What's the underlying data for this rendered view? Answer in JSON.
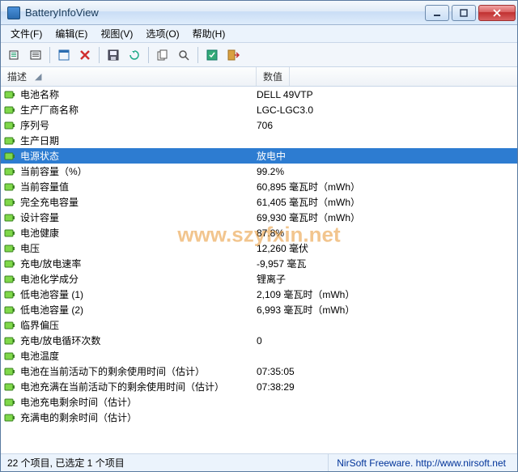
{
  "title": "BatteryInfoView",
  "menu": [
    "文件(F)",
    "编辑(E)",
    "视图(V)",
    "选项(O)",
    "帮助(H)"
  ],
  "columns": {
    "desc": "描述",
    "value": "数值"
  },
  "rows": [
    {
      "desc": "电池名称",
      "value": "DELL 49VTP",
      "selected": false
    },
    {
      "desc": "生产厂商名称",
      "value": "LGC-LGC3.0",
      "selected": false
    },
    {
      "desc": "序列号",
      "value": "    706",
      "selected": false
    },
    {
      "desc": "生产日期",
      "value": "",
      "selected": false
    },
    {
      "desc": "电源状态",
      "value": "放电中",
      "selected": true
    },
    {
      "desc": "当前容量（%）",
      "value": "99.2%",
      "selected": false
    },
    {
      "desc": "当前容量值",
      "value": "60,895 毫瓦时（mWh）",
      "selected": false
    },
    {
      "desc": "完全充电容量",
      "value": "61,405 毫瓦时（mWh）",
      "selected": false
    },
    {
      "desc": "设计容量",
      "value": "69,930 毫瓦时（mWh）",
      "selected": false
    },
    {
      "desc": "电池健康",
      "value": "87.8%",
      "selected": false
    },
    {
      "desc": "电压",
      "value": "12,260 毫伏",
      "selected": false
    },
    {
      "desc": "充电/放电速率",
      "value": "-9,957 毫瓦",
      "selected": false
    },
    {
      "desc": "电池化学成分",
      "value": "锂离子",
      "selected": false
    },
    {
      "desc": "低电池容量 (1)",
      "value": "2,109 毫瓦时（mWh）",
      "selected": false
    },
    {
      "desc": "低电池容量 (2)",
      "value": "6,993 毫瓦时（mWh）",
      "selected": false
    },
    {
      "desc": "临界偏压",
      "value": "",
      "selected": false
    },
    {
      "desc": "充电/放电循环次数",
      "value": "0",
      "selected": false
    },
    {
      "desc": "电池温度",
      "value": "",
      "selected": false
    },
    {
      "desc": "电池在当前活动下的剩余使用时间（估计）",
      "value": "07:35:05",
      "selected": false
    },
    {
      "desc": "电池充满在当前活动下的剩余使用时间（估计）",
      "value": "07:38:29",
      "selected": false
    },
    {
      "desc": "电池充电剩余时间（估计）",
      "value": "",
      "selected": false
    },
    {
      "desc": "充满电的剩余时间（估计）",
      "value": "",
      "selected": false
    }
  ],
  "status": {
    "left": "22 个项目, 已选定 1 个项目",
    "right": "NirSoft Freeware.  http://www.nirsoft.net"
  },
  "watermark": "www.szyfxin.net"
}
